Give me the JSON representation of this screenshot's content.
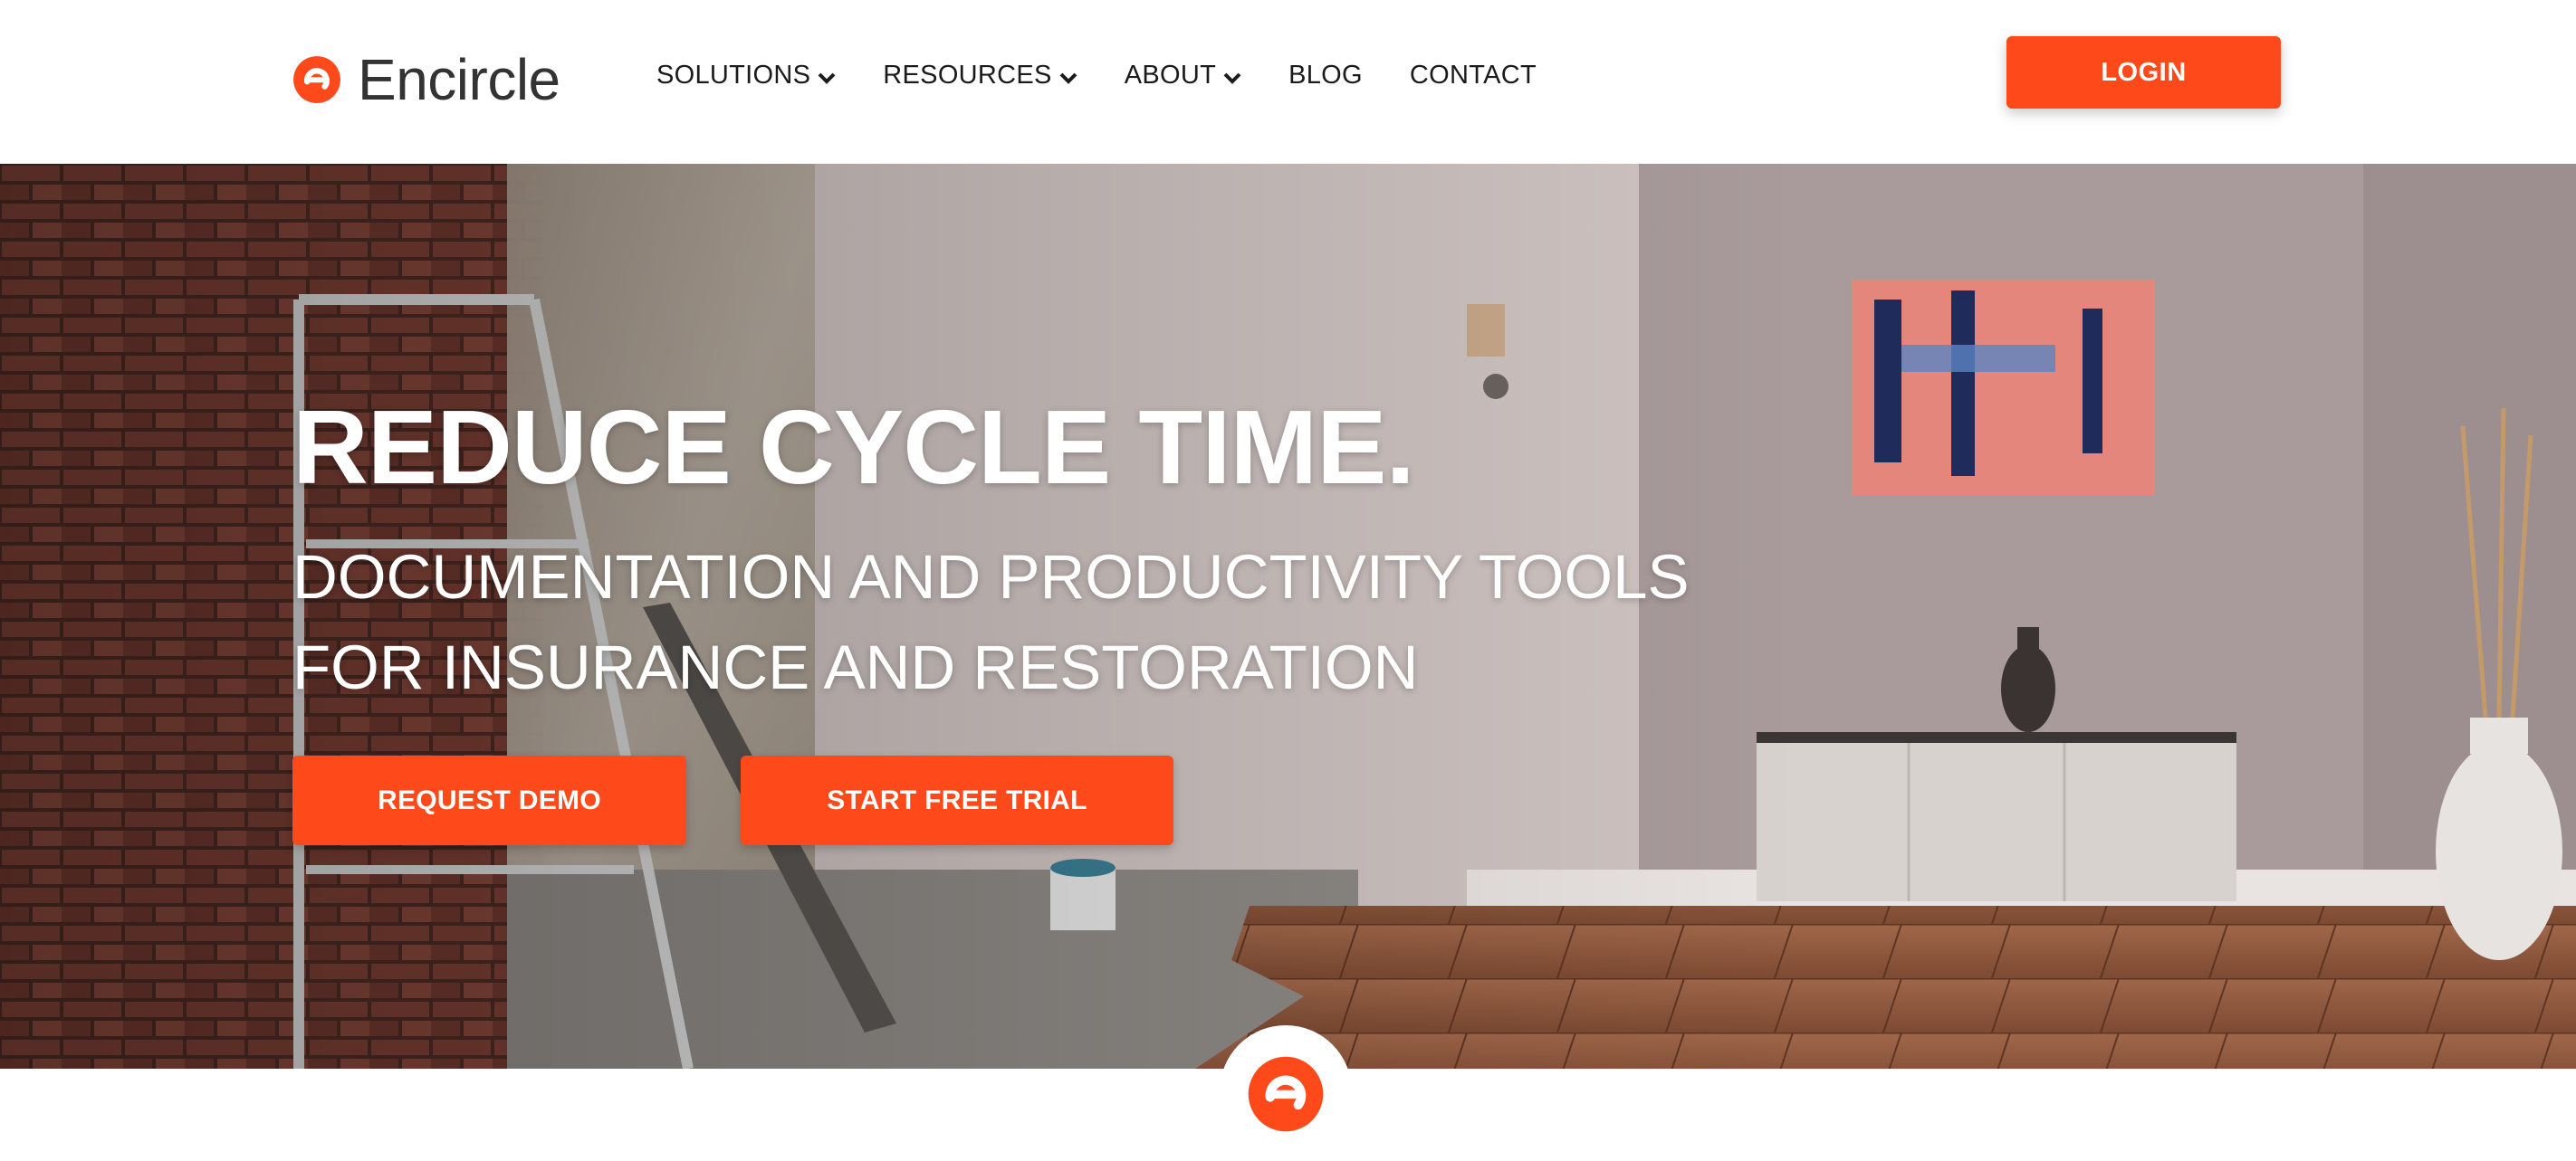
{
  "brand": {
    "name": "Encircle",
    "logo_icon": "encircle-e-icon",
    "accent_color": "#fe4a1a"
  },
  "nav": {
    "items": [
      {
        "label": "SOLUTIONS",
        "has_dropdown": true
      },
      {
        "label": "RESOURCES",
        "has_dropdown": true
      },
      {
        "label": "ABOUT",
        "has_dropdown": true
      },
      {
        "label": "BLOG",
        "has_dropdown": false
      },
      {
        "label": "CONTACT",
        "has_dropdown": false
      }
    ],
    "login_label": "LOGIN"
  },
  "hero": {
    "title": "REDUCE CYCLE TIME.",
    "subtitle_line1": "DOCUMENTATION AND PRODUCTIVITY TOOLS",
    "subtitle_line2": "FOR INSURANCE AND RESTORATION",
    "primary_cta": "REQUEST DEMO",
    "secondary_cta": "START FREE TRIAL"
  },
  "icons": {
    "dropdown": "chevron-down-icon",
    "bottom_badge": "encircle-e-icon"
  }
}
